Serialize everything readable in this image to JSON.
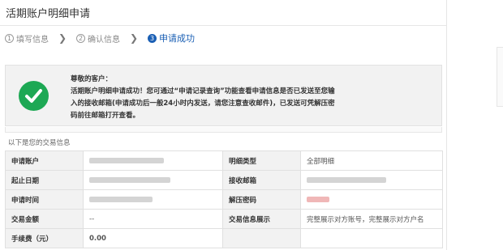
{
  "page": {
    "title": "活期账户明细申请"
  },
  "steps": [
    {
      "num": "1",
      "label": "填写信息",
      "active": false
    },
    {
      "num": "2",
      "label": "确认信息",
      "active": false
    },
    {
      "num": "3",
      "label": "申请成功",
      "active": true
    }
  ],
  "success": {
    "greeting": "尊敬的客户：",
    "message": "活期账户明细申请成功！您可通过“申请记录查询”功能查看申请信息是否已发送至您输入的接收邮箱(申请成功后一般24小时内发送，请您注意查收邮件)，已发送可凭解压密码前往邮箱打开查看。"
  },
  "section": {
    "title": "以下是您的交易信息"
  },
  "table": {
    "rows": [
      {
        "l1": "申请账户",
        "v1": "",
        "l2": "明细类型",
        "v2": "全部明细"
      },
      {
        "l1": "起止日期",
        "v1": "",
        "l2": "接收邮箱",
        "v2": ""
      },
      {
        "l1": "申请时间",
        "v1": "",
        "l2": "解压密码",
        "v2": ""
      },
      {
        "l1": "交易金额",
        "v1": "--",
        "l2": "交易信息展示",
        "v2": "完整展示对方账号，完整展示对方户名"
      },
      {
        "l1": "手续费（元）",
        "v1": "0.00",
        "l2": "",
        "v2": ""
      }
    ]
  },
  "colors": {
    "accent": "#1a5fb4",
    "success": "#1da854",
    "fee": "#d0021b"
  },
  "icons": {
    "success": "check-circle-icon"
  }
}
